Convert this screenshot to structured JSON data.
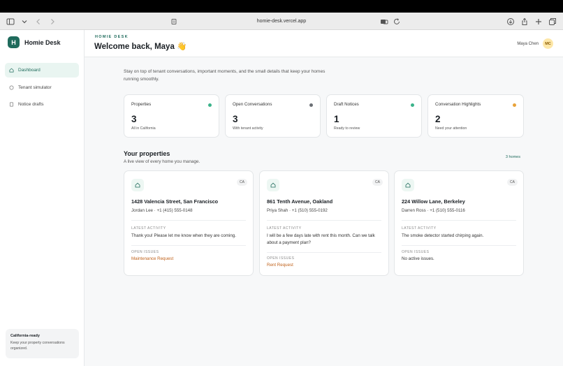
{
  "browser": {
    "url": "homie-desk.vercel.app"
  },
  "brand": {
    "logo_letter": "H",
    "name": "Homie Desk"
  },
  "nav": [
    {
      "label": "Dashboard",
      "active": true
    },
    {
      "label": "Tenant simulator",
      "active": false
    },
    {
      "label": "Notice drafts",
      "active": false
    }
  ],
  "side_card": {
    "title": "California-ready",
    "text": "Keep your property conversations organized."
  },
  "header": {
    "eyebrow": "HOMIE DESK",
    "welcome": "Welcome back, Maya 👋",
    "user_name": "Maya Chen",
    "avatar_initials": "MC"
  },
  "intro": "Stay on top of tenant conversations, important moments, and the small details that keep your homes running smoothly.",
  "stats": [
    {
      "label": "Properties",
      "value": "3",
      "sub": "All in California",
      "dot_color": "#3bb38a"
    },
    {
      "label": "Open Conversations",
      "value": "3",
      "sub": "With tenant activity",
      "dot_color": "#6b7075"
    },
    {
      "label": "Draft Notices",
      "value": "1",
      "sub": "Ready to review",
      "dot_color": "#3bb38a"
    },
    {
      "label": "Conversation Highlights",
      "value": "2",
      "sub": "Need your attention",
      "dot_color": "#e8a23a"
    }
  ],
  "properties_section": {
    "title": "Your properties",
    "subtitle": "A live view of every home you manage.",
    "count": "3 homes"
  },
  "properties": [
    {
      "badge": "CA",
      "address": "1428 Valencia Street, San Francisco",
      "tenant": "Jordan Lee · +1 (415) 555-0148",
      "activity_label": "LATEST ACTIVITY",
      "activity": "Thank you! Please let me know when they are coming.",
      "issues_label": "OPEN ISSUES",
      "issue": "Maintenance Request",
      "issue_color": "#c0621b"
    },
    {
      "badge": "CA",
      "address": "861 Tenth Avenue, Oakland",
      "tenant": "Priya Shah · +1 (510) 555-0192",
      "activity_label": "LATEST ACTIVITY",
      "activity": "I will be a few days late with rent this month. Can we talk about a payment plan?",
      "issues_label": "OPEN ISSUES",
      "issue": "Rent Request",
      "issue_color": "#c0621b"
    },
    {
      "badge": "CA",
      "address": "224 Willow Lane, Berkeley",
      "tenant": "Darren Ross · +1 (510) 555-0116",
      "activity_label": "LATEST ACTIVITY",
      "activity": "The smoke detector started chirping again.",
      "issues_label": "OPEN ISSUES",
      "issue": "No active issues.",
      "issue_color": "#333333"
    }
  ],
  "colors": {
    "accent": "#1f6b5c",
    "active_bg": "#e9f5f1",
    "warning": "#c0621b"
  }
}
